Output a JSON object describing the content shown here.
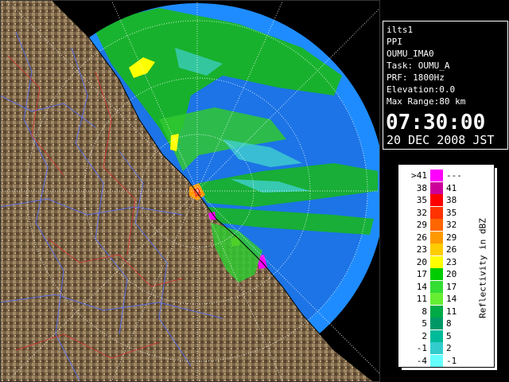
{
  "info": {
    "station": "ilts1",
    "scan_type": "PPI",
    "site_code": "OUMU_IMA0",
    "task": "Task: OUMU_A",
    "prf": "PRF: 1800Hz",
    "elevation": "Elevation:0.0",
    "max_range": "Max Range:80 km",
    "time": "07:30:00",
    "date": "20 DEC 2008 JST"
  },
  "legend": {
    "title": "Reflectivity in dBZ",
    "rows": [
      {
        "lo": ">41",
        "hi": "---",
        "color": "#ff00ff"
      },
      {
        "lo": "38",
        "hi": "41",
        "color": "#cc0099"
      },
      {
        "lo": "35",
        "hi": "38",
        "color": "#ff0000"
      },
      {
        "lo": "32",
        "hi": "35",
        "color": "#ff3300"
      },
      {
        "lo": "29",
        "hi": "32",
        "color": "#ff6600"
      },
      {
        "lo": "26",
        "hi": "29",
        "color": "#ff9900"
      },
      {
        "lo": "23",
        "hi": "26",
        "color": "#ffcc00"
      },
      {
        "lo": "20",
        "hi": "23",
        "color": "#ffff00"
      },
      {
        "lo": "17",
        "hi": "20",
        "color": "#00cc00"
      },
      {
        "lo": "14",
        "hi": "17",
        "color": "#33dd33"
      },
      {
        "lo": "11",
        "hi": "14",
        "color": "#66ee33"
      },
      {
        "lo": "8",
        "hi": "11",
        "color": "#00aa44"
      },
      {
        "lo": "5",
        "hi": "8",
        "color": "#009966"
      },
      {
        "lo": "2",
        "hi": "5",
        "color": "#00bb99"
      },
      {
        "lo": "-1",
        "hi": "2",
        "color": "#33cccc"
      },
      {
        "lo": "-4",
        "hi": "-1",
        "color": "#66ffff"
      }
    ]
  },
  "colors": {
    "sea": "#1e7ff0",
    "range_ring_fill": "#2060ff",
    "land": "#8a7050",
    "border": "#ffffff"
  }
}
